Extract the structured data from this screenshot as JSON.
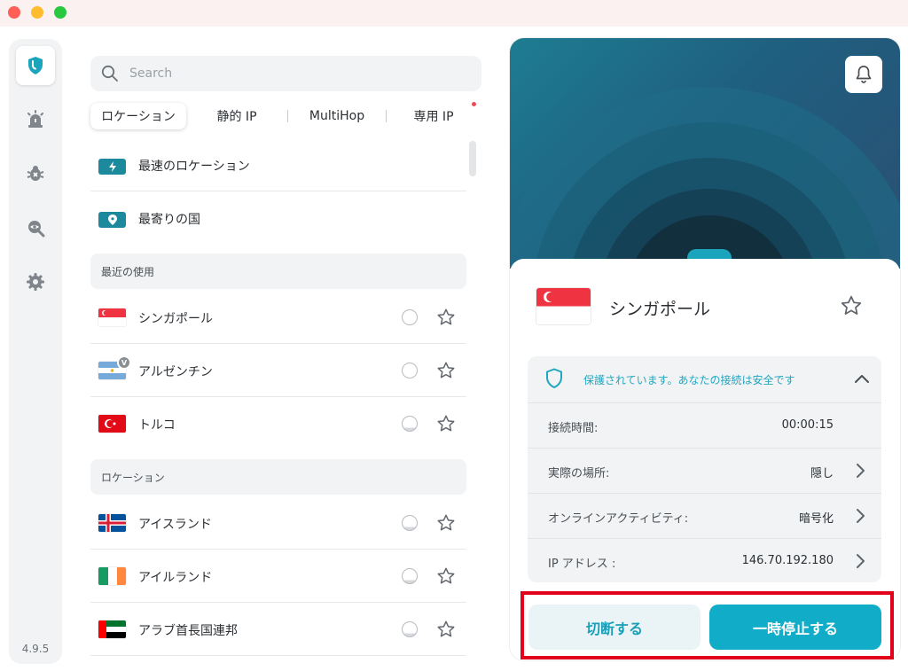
{
  "window": {
    "controls": [
      "close",
      "minimize",
      "zoom"
    ]
  },
  "sidebar": {
    "items": [
      {
        "icon": "shield-icon",
        "active": true
      },
      {
        "icon": "alert-siren-icon",
        "active": false
      },
      {
        "icon": "bug-icon",
        "active": false
      },
      {
        "icon": "search-eye-icon",
        "active": false
      },
      {
        "icon": "gear-icon",
        "active": false
      }
    ],
    "version": "4.9.5"
  },
  "search": {
    "placeholder": "Search",
    "value": ""
  },
  "tabs": [
    {
      "label": "ロケーション",
      "active": true
    },
    {
      "label": "静的 IP",
      "active": false
    },
    {
      "label": "MultiHop",
      "active": false
    },
    {
      "label": "専用 IP",
      "active": false,
      "notification_dot": true
    }
  ],
  "quick": [
    {
      "label": "最速のロケーション",
      "icon": "lightning-icon"
    },
    {
      "label": "最寄りの国",
      "icon": "location-pin-icon"
    }
  ],
  "recent": {
    "title": "最近の使用",
    "items": [
      {
        "label": "シンガポール",
        "flag": "SG",
        "load": "empty"
      },
      {
        "label": "アルゼンチン",
        "flag": "AR",
        "load": "empty",
        "badge": "V"
      },
      {
        "label": "トルコ",
        "flag": "TR",
        "load": "low"
      }
    ]
  },
  "locations": {
    "title": "ロケーション",
    "items": [
      {
        "label": "アイスランド",
        "flag": "IS",
        "load": "low"
      },
      {
        "label": "アイルランド",
        "flag": "IE",
        "load": "low"
      },
      {
        "label": "アラブ首長国連邦",
        "flag": "AE",
        "load": "low"
      }
    ]
  },
  "connection": {
    "country": "シンガポール",
    "flag": "SG",
    "status_text": "保護されています。あなたの接続は安全です",
    "rows": [
      {
        "key": "接続時間:",
        "value": "00:00:15",
        "chevron": false
      },
      {
        "key": "実際の場所:",
        "value": "隠し",
        "chevron": true
      },
      {
        "key": "オンラインアクティビティ:",
        "value": "暗号化",
        "chevron": true
      },
      {
        "key": "IP アドレス :",
        "value": "146.70.192.180",
        "chevron": true
      }
    ],
    "disconnect_label": "切断する",
    "pause_label": "一時停止する"
  },
  "colors": {
    "accent": "#10acc8",
    "accent_dark": "#1c8a9c",
    "highlight_box": "#e3001b",
    "status_text": "#21a6c0"
  }
}
